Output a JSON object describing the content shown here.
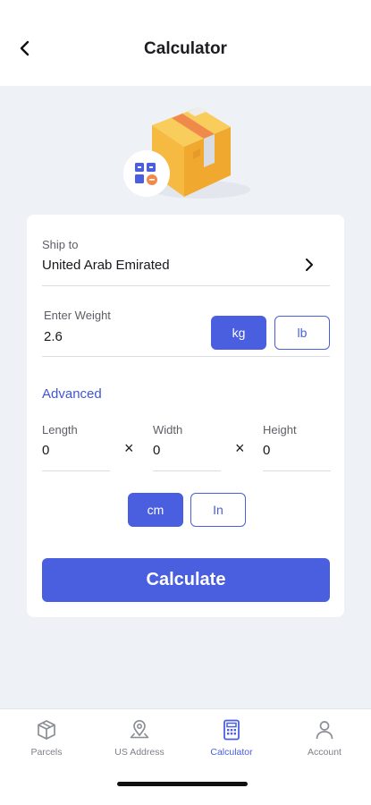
{
  "header": {
    "title": "Calculator"
  },
  "ship_to": {
    "label": "Ship to",
    "value": "United Arab Emirated"
  },
  "weight": {
    "label": "Enter Weight",
    "value": "2.6",
    "unit_kg": "kg",
    "unit_lb": "lb",
    "selected_unit": "kg"
  },
  "advanced": {
    "label": "Advanced",
    "length_label": "Length",
    "length_value": "0",
    "width_label": "Width",
    "width_value": "0",
    "height_label": "Height",
    "height_value": "0",
    "times_symbol": "×",
    "unit_cm": "cm",
    "unit_in": "In",
    "selected_unit": "cm"
  },
  "calculate_label": "Calculate",
  "tabbar": {
    "tabs": [
      {
        "label": "Parcels",
        "icon": "parcel-box-icon"
      },
      {
        "label": "US Address",
        "icon": "location-pin-icon"
      },
      {
        "label": "Calculator",
        "icon": "calculator-icon"
      },
      {
        "label": "Account",
        "icon": "user-icon"
      }
    ],
    "active": "Calculator"
  },
  "colors": {
    "accent": "#4a5ee0",
    "background": "#eef2f6",
    "box": "#f6b941",
    "tape": "#f08a4b"
  }
}
